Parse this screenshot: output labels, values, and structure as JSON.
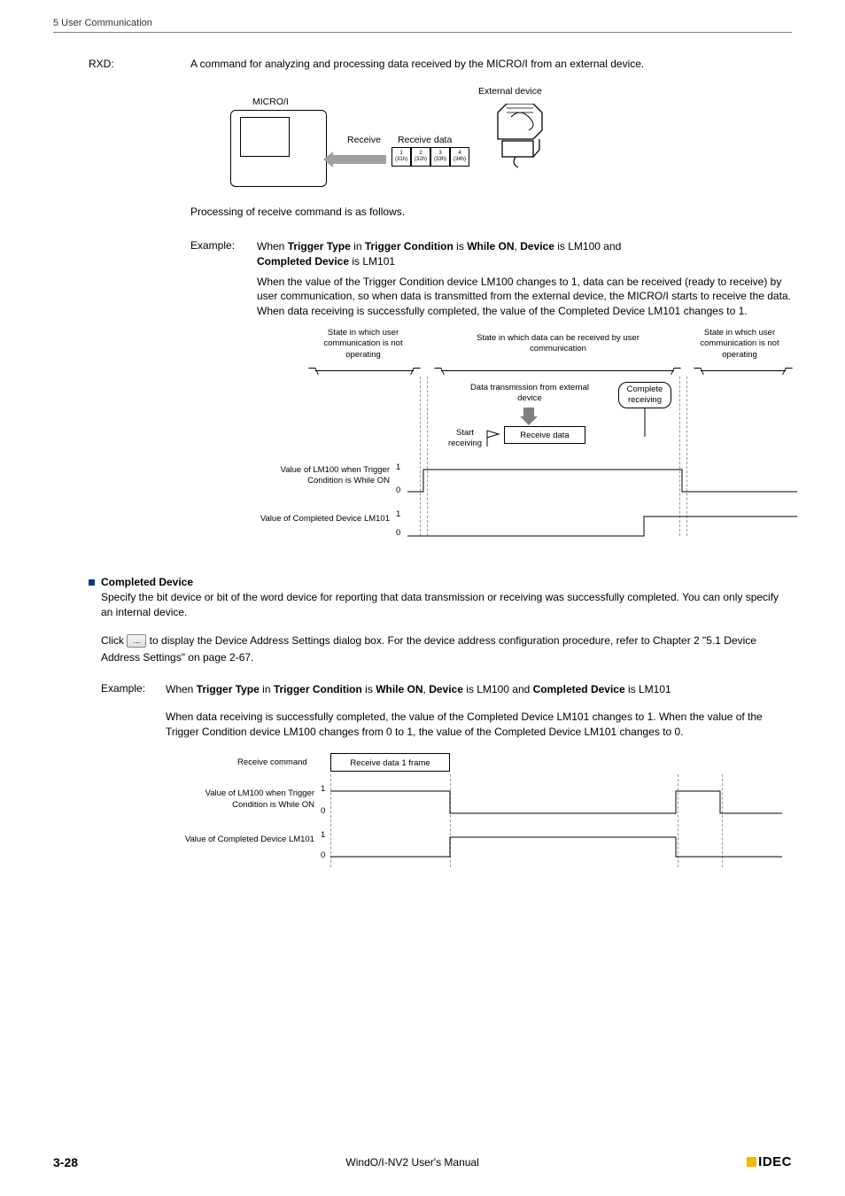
{
  "header": {
    "section": "5 User Communication"
  },
  "rxd": {
    "label": "RXD:",
    "text": "A command for analyzing and processing data received by the MICRO/I from an external device."
  },
  "diagram1": {
    "external_device": "External device",
    "microi": "MICRO/I",
    "receive": "Receive",
    "receive_data": "Receive data",
    "bytes": [
      {
        "n": "1",
        "h": "(31h)"
      },
      {
        "n": "2",
        "h": "(32h)"
      },
      {
        "n": "3",
        "h": "(33h)"
      },
      {
        "n": "4",
        "h": "(34h)"
      }
    ]
  },
  "processing_text": "Processing of receive command is as follows.",
  "example1": {
    "label": "Example:",
    "line_pre": "When ",
    "tt": "Trigger Type",
    "in": " in ",
    "tc": "Trigger Condition",
    "is": " is ",
    "wo": "While ON",
    "comma": ", ",
    "dev": "Device",
    "is2": " is LM100 and ",
    "cd": "Completed Device",
    "tail": " is LM101",
    "desc": "When the value of the Trigger Condition device LM100 changes to 1, data can be received (ready to receive) by user communication, so when data is transmitted from the external device, the MICRO/I starts to receive the data. When data receiving is successfully completed, the value of the Completed Device LM101 changes to 1."
  },
  "diagram2": {
    "state1": "State in which user communication is not operating",
    "state2": "State in which data can be received by user communication",
    "state3": "State in which user communication is not operating",
    "data_trans": "Data transmission from external device",
    "complete": "Complete receiving",
    "start": "Start receiving",
    "recv_data": "Receive data",
    "label1": "Value of LM100 when Trigger Condition is While ON",
    "label2": "Value of Completed Device LM101",
    "lv1": "1",
    "lv0": "0"
  },
  "completed_device": {
    "title": "Completed Device",
    "para1": "Specify the bit device or bit of the word device for reporting that data transmission or receiving was successfully completed. You can only specify an internal device.",
    "para2_pre": "Click ",
    "btn": "...",
    "para2_post": " to display the Device Address Settings dialog box. For the device address configuration procedure, refer to Chapter 2 \"5.1 Device Address Settings\" on page 2-67."
  },
  "example2": {
    "label": "Example:",
    "line_pre": "When ",
    "tt": "Trigger Type",
    "in": " in ",
    "tc": "Trigger Condition",
    "is": " is ",
    "wo": "While ON",
    "comma": ", ",
    "dev": "Device",
    "mid": " is LM100 and ",
    "cd": "Completed Device",
    "tail": " is LM101",
    "desc": "When data receiving is successfully completed, the value of the Completed Device LM101 changes to 1. When the value of the Trigger Condition device LM100 changes from 0 to 1, the value of the Completed Device LM101 changes to 0."
  },
  "diagram3": {
    "rc": "Receive command",
    "rd1f": "Receive data 1 frame",
    "label1": "Value of LM100 when Trigger Condition is While ON",
    "label2": "Value of Completed Device LM101",
    "lv1": "1",
    "lv0": "0"
  },
  "footer": {
    "page": "3-28",
    "title": "WindO/I-NV2 User's Manual",
    "logo": "IDEC"
  }
}
